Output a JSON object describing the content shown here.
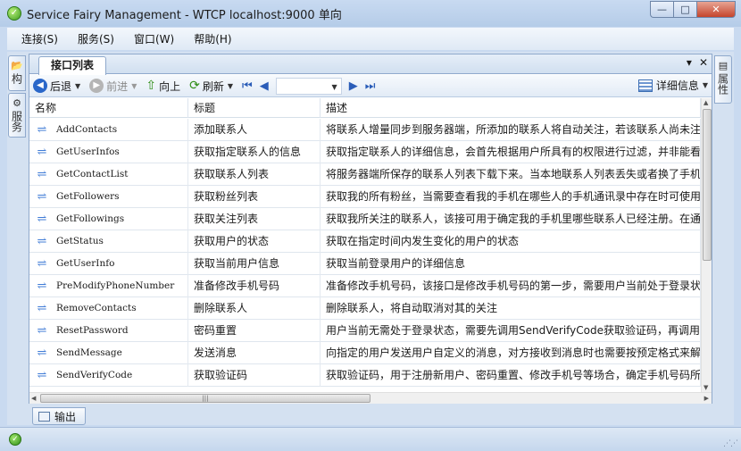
{
  "window": {
    "title": "Service Fairy Management - WTCP localhost:9000 单向",
    "minimize": "—",
    "maximize": "□",
    "close": "✕"
  },
  "menu": [
    {
      "label": "连接(S)"
    },
    {
      "label": "服务(S)"
    },
    {
      "label": "窗口(W)"
    },
    {
      "label": "帮助(H)"
    }
  ],
  "side_left": [
    {
      "label": "构",
      "icon": "tree-icon"
    },
    {
      "label": "服务",
      "icon": "service-icon"
    }
  ],
  "side_right": [
    {
      "label": "属性",
      "icon": "properties-icon"
    }
  ],
  "document": {
    "tab_label": "接口列表",
    "dropdown_glyph": "▾",
    "close_glyph": "✕"
  },
  "toolbar": {
    "back": "后退",
    "forward": "前进",
    "up": "向上",
    "refresh": "刷新",
    "detail": "详细信息"
  },
  "list": {
    "columns": [
      "名称",
      "标题",
      "描述"
    ],
    "rows": [
      {
        "name": "AddContacts",
        "title": "添加联系人",
        "desc": "将联系人增量同步到服务器端，所添加的联系人将自动关注，若该联系人尚未注"
      },
      {
        "name": "GetUserInfos",
        "title": "获取指定联系人的信息",
        "desc": "获取指定联系人的详细信息，会首先根据用户所具有的权限进行过滤，并非能看"
      },
      {
        "name": "GetContactList",
        "title": "获取联系人列表",
        "desc": "将服务器端所保存的联系人列表下载下来。当本地联系人列表丢失或者换了手机"
      },
      {
        "name": "GetFollowers",
        "title": "获取粉丝列表",
        "desc": "获取我的所有粉丝，当需要查看我的手机在哪些人的手机通讯录中存在时可使用"
      },
      {
        "name": "GetFollowings",
        "title": "获取关注列表",
        "desc": "获取我所关注的联系人，该接可用于确定我的手机里哪些联系人已经注册。在通"
      },
      {
        "name": "GetStatus",
        "title": "获取用户的状态",
        "desc": "获取在指定时间内发生变化的用户的状态"
      },
      {
        "name": "GetUserInfo",
        "title": "获取当前用户信息",
        "desc": "获取当前登录用户的详细信息"
      },
      {
        "name": "PreModifyPhoneNumber",
        "title": "准备修改手机号码",
        "desc": "准备修改手机号码，该接口是修改手机号码的第一步，需要用户当前处于登录状"
      },
      {
        "name": "RemoveContacts",
        "title": "删除联系人",
        "desc": "删除联系人，将自动取消对其的关注"
      },
      {
        "name": "ResetPassword",
        "title": "密码重置",
        "desc": "用户当前无需处于登录状态，需要先调用SendVerifyCode获取验证码，再调用该"
      },
      {
        "name": "SendMessage",
        "title": "发送消息",
        "desc": "向指定的用户发送用户自定义的消息，对方接收到消息时也需要按预定格式来解"
      },
      {
        "name": "SendVerifyCode",
        "title": "获取验证码",
        "desc": "获取验证码，用于注册新用户、密码重置、修改手机号等场合，确定手机号码所有"
      }
    ]
  },
  "output_tab": "输出",
  "colors": {
    "accent": "#3f7bd6",
    "titlebar": "#c8daf1",
    "close": "#c4452c"
  }
}
